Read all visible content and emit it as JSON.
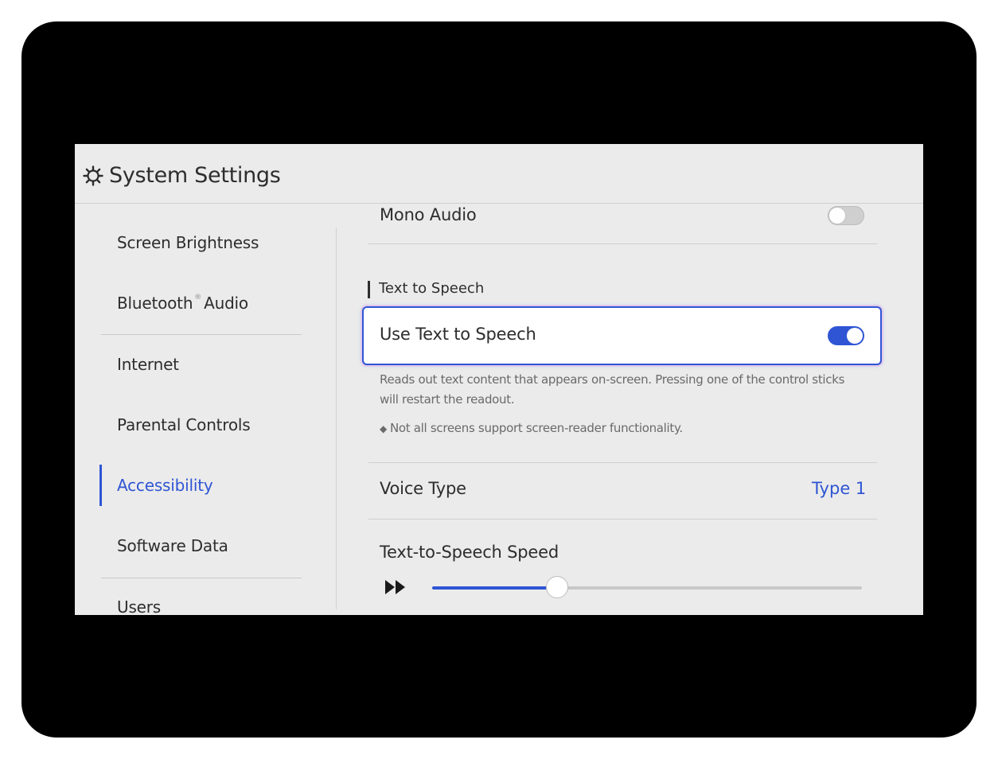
{
  "header": {
    "title": "System Settings",
    "icon": "gear-icon"
  },
  "sidebar": {
    "items": [
      {
        "label": "Screen Brightness"
      },
      {
        "label": "Bluetooth",
        "superscript": "®",
        "suffix": "Audio"
      },
      {
        "label": "Internet"
      },
      {
        "label": "Parental Controls"
      },
      {
        "label": "Accessibility",
        "active": true
      },
      {
        "label": "Software Data"
      },
      {
        "label": "Users"
      }
    ]
  },
  "main": {
    "mono_audio": {
      "label": "Mono Audio",
      "enabled": false
    },
    "tts_section": {
      "heading": "Text to Speech"
    },
    "use_tts": {
      "label": "Use Text to Speech",
      "enabled": true
    },
    "tts_description": "Reads out text content that appears on-screen. Pressing one of the control sticks will restart the readout.",
    "tts_note": "Not all screens support screen-reader functionality.",
    "voice_type": {
      "label": "Voice Type",
      "value": "Type 1"
    },
    "tts_speed": {
      "label": "Text-to-Speech Speed",
      "level": 0.29,
      "icon": "fast-forward-icon"
    }
  },
  "colors": {
    "accent": "#2f55d4",
    "background": "#ebebeb",
    "frame": "#000000"
  }
}
